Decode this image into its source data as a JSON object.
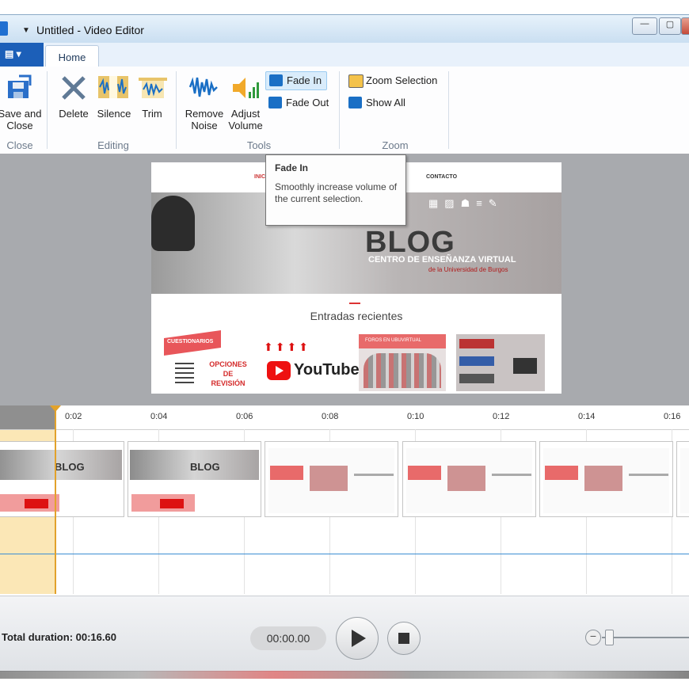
{
  "window": {
    "title": "Untitled - Video Editor"
  },
  "ribbon": {
    "tabs": [
      "Home"
    ],
    "groups": {
      "close": {
        "label": "Close",
        "save_and_close": "Save and\nClose"
      },
      "editing": {
        "label": "Editing",
        "delete": "Delete",
        "silence": "Silence",
        "trim": "Trim"
      },
      "tools": {
        "label": "Tools",
        "remove_noise": "Remove\nNoise",
        "adjust_volume": "Adjust\nVolume",
        "fade_in": "Fade In",
        "fade_out": "Fade Out"
      },
      "zoom": {
        "label": "Zoom",
        "zoom_selection": "Zoom Selection",
        "show_all": "Show All"
      }
    }
  },
  "tooltip": {
    "title": "Fade In",
    "body": "Smoothly increase volume of the current selection."
  },
  "preview": {
    "nav_items": [
      "INICIO",
      "CONTACTO"
    ],
    "blog_title": "BLOG",
    "blog_subtitle": "CENTRO DE ENSEÑANZA VIRTUAL",
    "blog_subtitle2": "de la Universidad de Burgos",
    "recent_heading": "Entradas recientes",
    "thumb1_title": "CUESTIONARIOS",
    "thumb1_text": "OPCIONES\nDE\nREVISIÓN",
    "thumb2_text": "YouTube",
    "thumb3_title": "FOROS EN UBUVIRTUAL"
  },
  "timeline": {
    "ticks": [
      "0:02",
      "0:04",
      "0:06",
      "0:08",
      "0:10",
      "0:12",
      "0:14",
      "0:16"
    ]
  },
  "playback": {
    "total_duration": "Total duration: 00:16.60",
    "current_time": "00:00.00",
    "zoom_minus": "−"
  },
  "colors": {
    "accent": "#1c5fb8",
    "selection": "#fbe7b6",
    "playhead": "#e2a22b",
    "waveform_line": "#3b8ed3"
  }
}
